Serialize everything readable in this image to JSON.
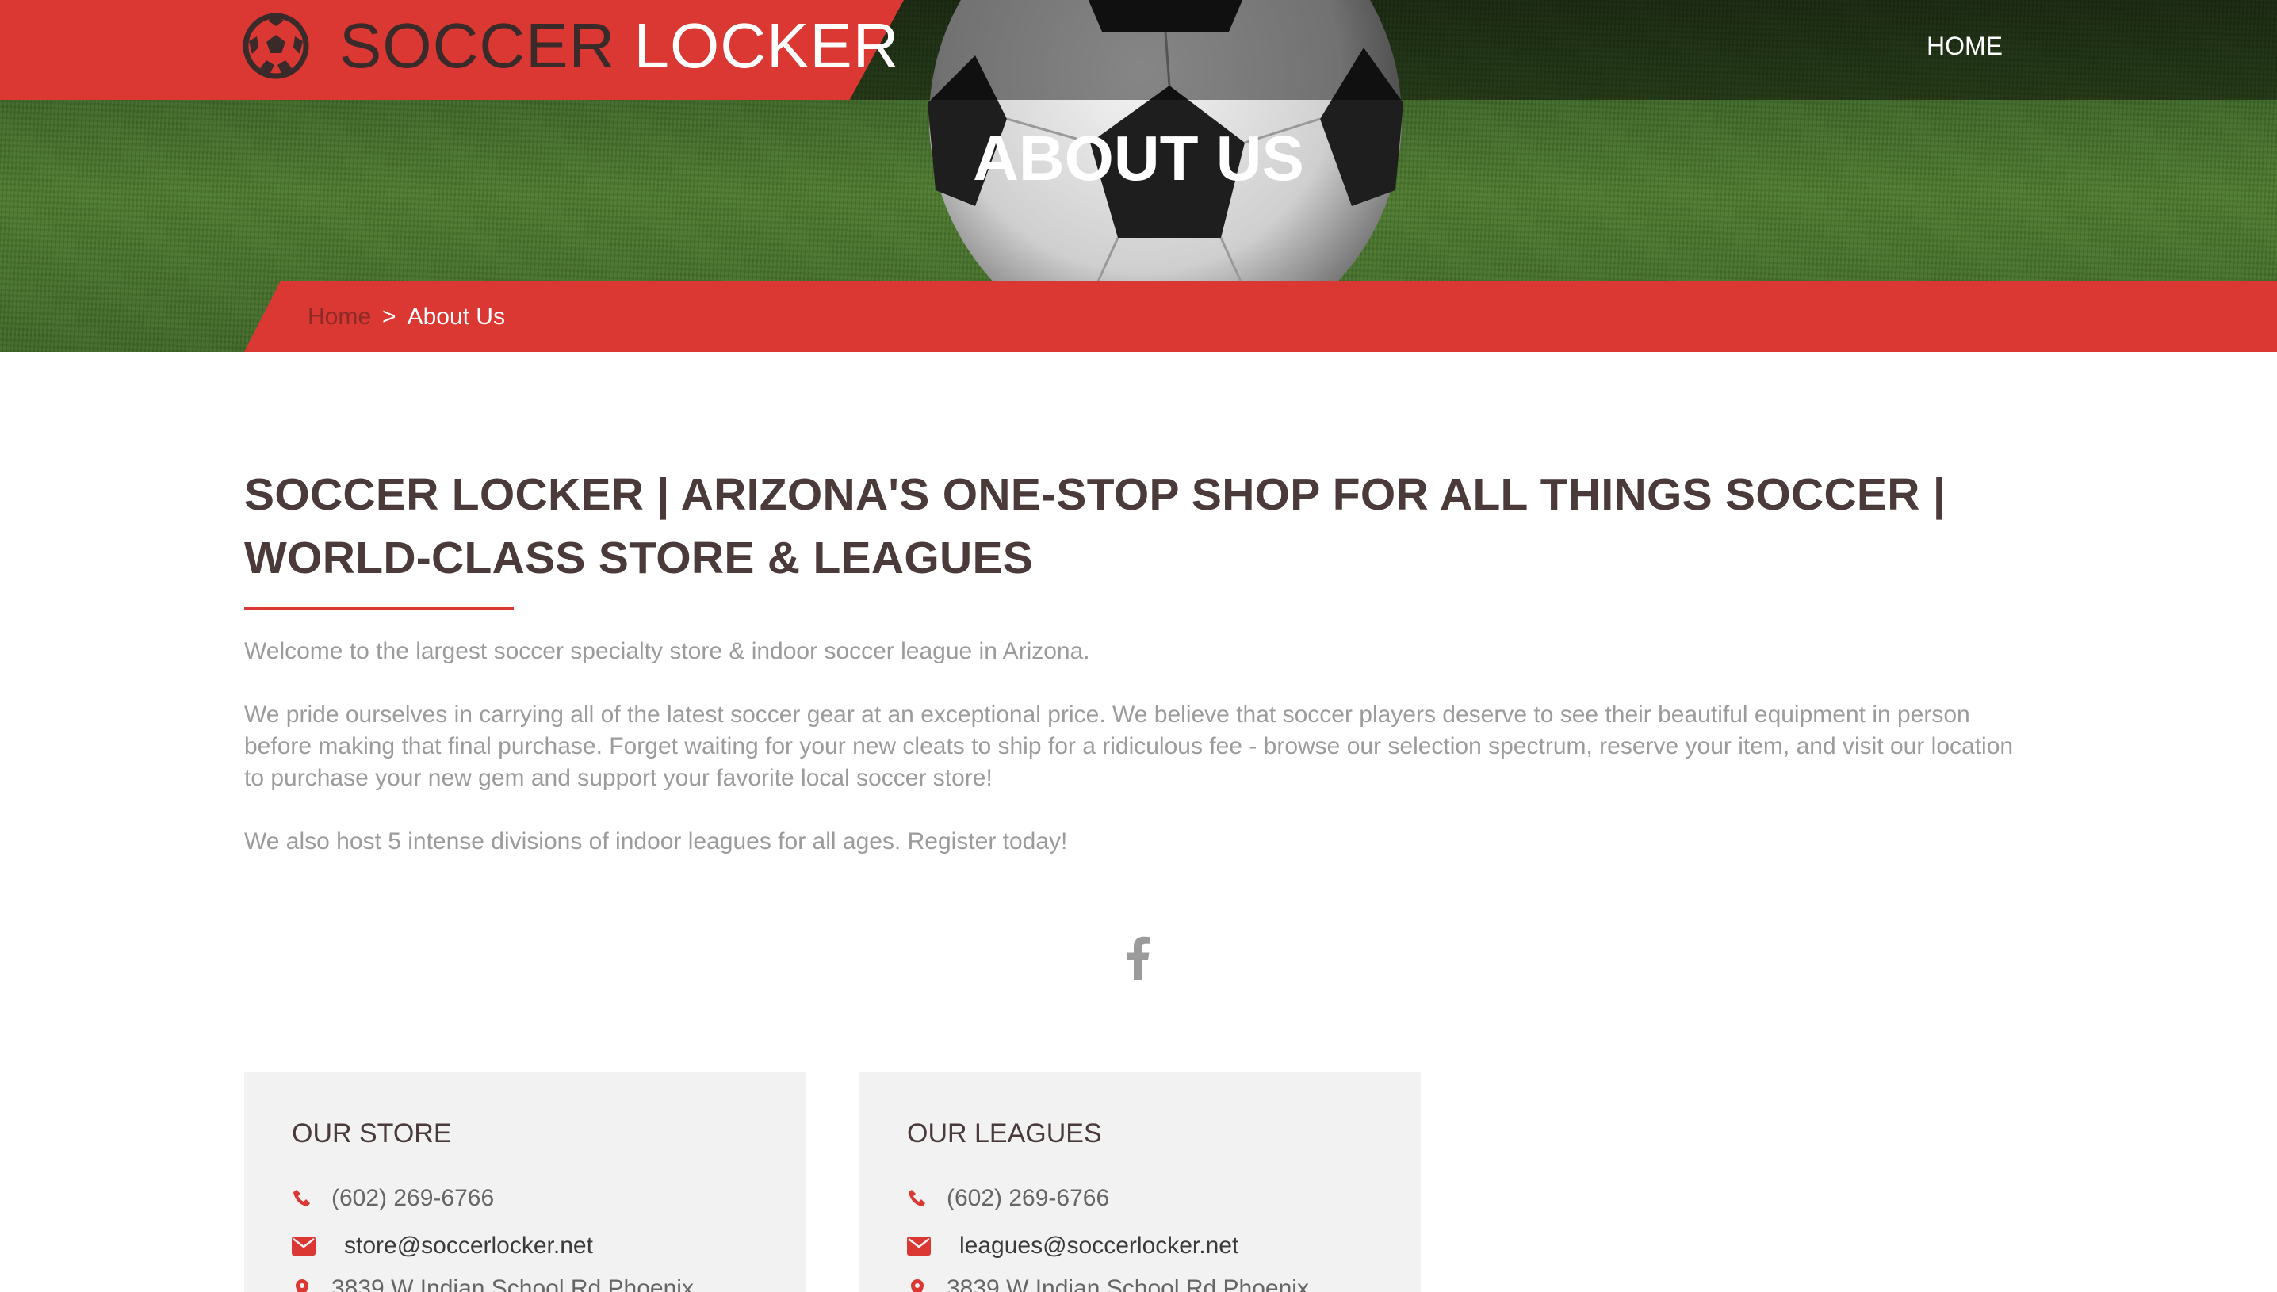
{
  "header": {
    "logo_word1": "SOCCER",
    "logo_word2": "LOCKER",
    "nav_home": "HOME"
  },
  "hero": {
    "title": "ABOUT US"
  },
  "breadcrumb": {
    "home": "Home",
    "separator": ">",
    "current": "About Us"
  },
  "main": {
    "heading": "SOCCER LOCKER | ARIZONA'S ONE-STOP SHOP FOR ALL THINGS SOCCER | WORLD-CLASS STORE & LEAGUES",
    "paragraphs": [
      "Welcome to the largest soccer specialty store & indoor soccer league in Arizona.",
      "We pride ourselves in carrying all of the latest soccer gear at an exceptional price. We believe that soccer players deserve to see their beautiful equipment in person before making that final purchase. Forget waiting for your new cleats to ship for a ridiculous fee - browse our selection spectrum, reserve your item, and visit our location to purchase your new gem and support your favorite local soccer store!",
      "We also host 5 intense divisions of indoor leagues for all ages. Register today!"
    ],
    "social_icon": "facebook-icon"
  },
  "cards": [
    {
      "title": "OUR STORE",
      "phone": "(602) 269-6766",
      "email": "store@soccerlocker.net",
      "address": "3839 W Indian School Rd Phoenix"
    },
    {
      "title": "OUR LEAGUES",
      "phone": "(602) 269-6766",
      "email": "leagues@soccerlocker.net",
      "address": "3839 W Indian School Rd Phoenix"
    }
  ],
  "colors": {
    "accent_red": "#db3833",
    "heading_text": "#4a3a3a",
    "body_text": "#9b9b9b",
    "card_bg": "#f2f2f2"
  }
}
